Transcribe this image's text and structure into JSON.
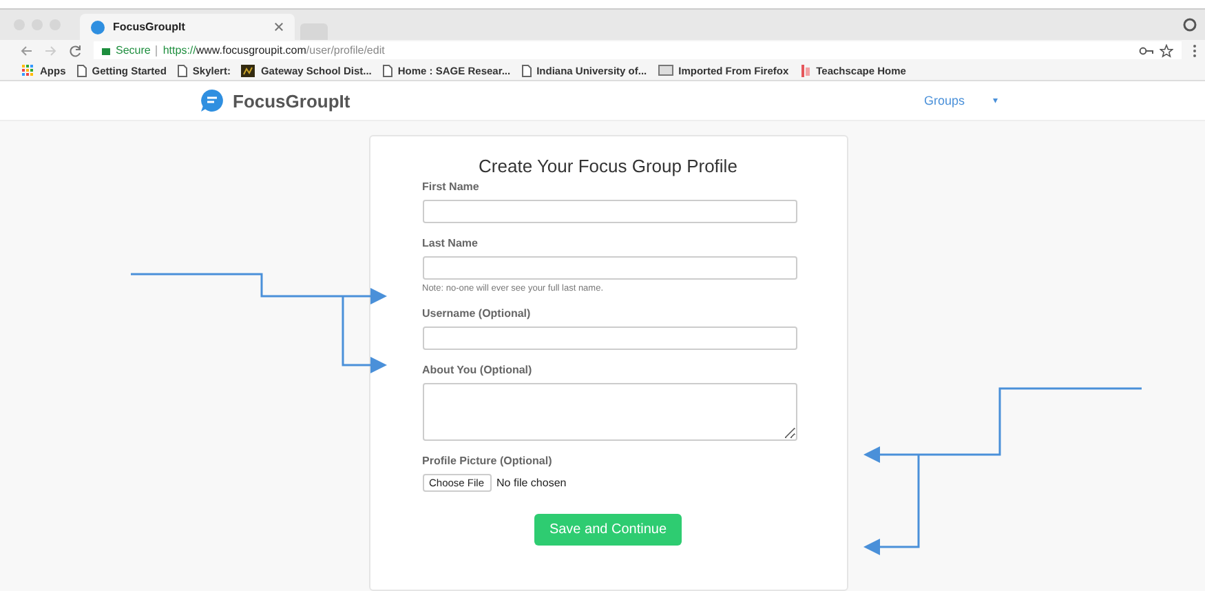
{
  "browser": {
    "tab": {
      "title": "FocusGroupIt"
    },
    "address": {
      "secure_label": "Secure",
      "scheme": "https://",
      "host": "www.focusgroupit.com",
      "path": "/user/profile/edit"
    },
    "bookmarks": [
      {
        "label": "Apps",
        "kind": "apps"
      },
      {
        "label": "Getting Started",
        "kind": "page"
      },
      {
        "label": "Skylert:",
        "kind": "page"
      },
      {
        "label": "Gateway School Dist...",
        "kind": "image"
      },
      {
        "label": "Home : SAGE Resear...",
        "kind": "page"
      },
      {
        "label": "Indiana University of...",
        "kind": "page"
      },
      {
        "label": "Imported From Firefox",
        "kind": "folder"
      },
      {
        "label": "Teachscape Home",
        "kind": "site"
      }
    ]
  },
  "site": {
    "brand": "FocusGroupIt",
    "nav": {
      "label": "Groups",
      "caret": "▾"
    }
  },
  "form": {
    "title": "Create Your Focus Group Profile",
    "fields": [
      {
        "kind": "text",
        "label": "First Name"
      },
      {
        "kind": "text",
        "label": "Last Name",
        "note": "Note: no-one will ever see your full last name."
      },
      {
        "kind": "text",
        "label": "Username (Optional)"
      },
      {
        "kind": "textarea",
        "label": "About You (Optional)"
      },
      {
        "kind": "file",
        "label": "Profile Picture (Optional)",
        "button": "Choose File",
        "status": "No file chosen"
      }
    ],
    "submit": "Save and Continue"
  }
}
